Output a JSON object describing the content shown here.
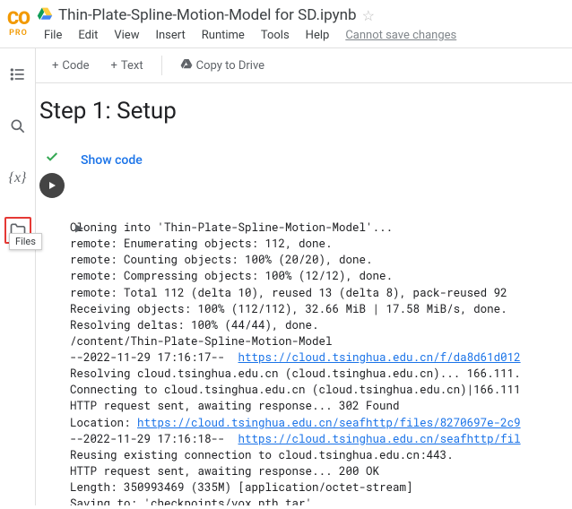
{
  "header": {
    "logo_text": "CO",
    "logo_sub": "PRO",
    "title": "Thin-Plate-Spline-Motion-Model for SD.ipynb",
    "menu": [
      "File",
      "Edit",
      "View",
      "Insert",
      "Runtime",
      "Tools",
      "Help"
    ],
    "save_status": "Cannot save changes"
  },
  "toolbar": {
    "code": "Code",
    "text": "Text",
    "copy": "Copy to Drive"
  },
  "leftbar": {
    "tooltip": "Files",
    "var_label": "{x}"
  },
  "cell": {
    "heading": "Step 1: Setup",
    "showcode": "Show code"
  },
  "output_lines": [
    {
      "t": "Cloning into 'Thin-Plate-Spline-Motion-Model'..."
    },
    {
      "t": "remote: Enumerating objects: 112, done."
    },
    {
      "t": "remote: Counting objects: 100% (20/20), done."
    },
    {
      "t": "remote: Compressing objects: 100% (12/12), done."
    },
    {
      "t": "remote: Total 112 (delta 10), reused 13 (delta 8), pack-reused 92"
    },
    {
      "t": "Receiving objects: 100% (112/112), 32.66 MiB | 17.58 MiB/s, done."
    },
    {
      "t": "Resolving deltas: 100% (44/44), done."
    },
    {
      "t": "/content/Thin-Plate-Spline-Motion-Model"
    },
    {
      "t": "--2022-11-29 17:16:17--  ",
      "link": "https://cloud.tsinghua.edu.cn/f/da8d61d012"
    },
    {
      "t": "Resolving cloud.tsinghua.edu.cn (cloud.tsinghua.edu.cn)... 166.111."
    },
    {
      "t": "Connecting to cloud.tsinghua.edu.cn (cloud.tsinghua.edu.cn)|166.111"
    },
    {
      "t": "HTTP request sent, awaiting response... 302 Found"
    },
    {
      "t": "Location: ",
      "link": "https://cloud.tsinghua.edu.cn/seafhttp/files/8270697e-2c9"
    },
    {
      "t": "--2022-11-29 17:16:18--  ",
      "link": "https://cloud.tsinghua.edu.cn/seafhttp/fil"
    },
    {
      "t": "Reusing existing connection to cloud.tsinghua.edu.cn:443."
    },
    {
      "t": "HTTP request sent, awaiting response... 200 OK"
    },
    {
      "t": "Length: 350993469 (335M) [application/octet-stream]"
    },
    {
      "t": "Saving to: 'checkpoints/vox.pth.tar'"
    }
  ]
}
